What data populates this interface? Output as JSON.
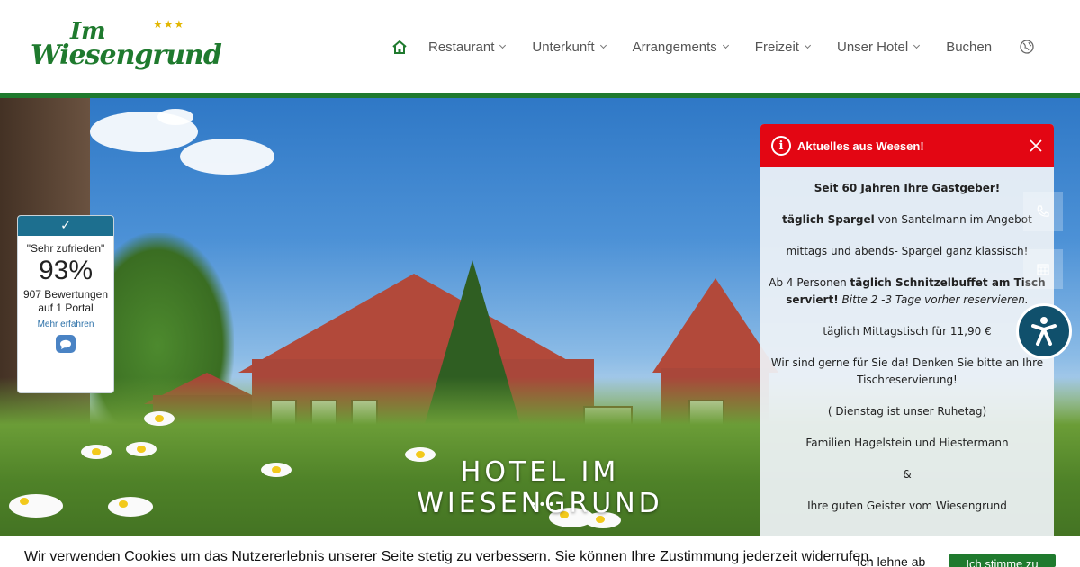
{
  "header": {
    "logo": {
      "im": "Im",
      "name": "Wiesengrund",
      "stars": "★★★"
    },
    "nav": [
      {
        "label": "Restaurant",
        "dropdown": true
      },
      {
        "label": "Unterkunft",
        "dropdown": true
      },
      {
        "label": "Arrangements",
        "dropdown": true
      },
      {
        "label": "Freizeit",
        "dropdown": true
      },
      {
        "label": "Unser Hotel",
        "dropdown": true
      },
      {
        "label": "Buchen",
        "dropdown": false
      }
    ],
    "icons": {
      "home": "home-icon",
      "language": "globe-icon"
    }
  },
  "hero": {
    "title": "HOTEL IM WIESENGRUND",
    "dots": "•••"
  },
  "rating": {
    "label": "\"Sehr zufrieden\"",
    "percent": "93%",
    "reviews": "907 Bewertungen auf 1 Portal",
    "link": "Mehr erfahren"
  },
  "news": {
    "title": "Aktuelles aus Weesen!",
    "p1": "Seit 60 Jahren Ihre Gastgeber!",
    "p2_bold": "täglich Spargel",
    "p2_rest": " von Santelmann im Angebot",
    "p3": "mittags und abends- Spargel ganz klassisch!",
    "p4_start": "Ab 4 Personen ",
    "p4_bold": "täglich Schnitzelbuffet am Tisch serviert!",
    "p4_italic": " Bitte 2 -3 Tage vorher reservieren.",
    "p5": "täglich Mittagstisch für 11,90 €",
    "p6": "Wir sind gerne für Sie da! Denken Sie bitte an Ihre Tischreservierung!",
    "p7": "( Dienstag ist unser Ruhetag)",
    "p8": "Familien Hagelstein und Hiestermann",
    "p9": "&",
    "p10": "Ihre guten Geister vom Wiesengrund"
  },
  "cookie": {
    "text": "Wir verwenden Cookies um das Nutzererlebnis unserer Seite stetig zu verbessern. Sie können Ihre Zustimmung jederzeit widerrufen.",
    "link": "Ich lehne ab",
    "button": "Ich stimme zu"
  },
  "colors": {
    "brand_green": "#1f7a2e",
    "alert_red": "#e30613",
    "rating_blue": "#1d6f8f",
    "a11y_blue": "#10506c"
  }
}
